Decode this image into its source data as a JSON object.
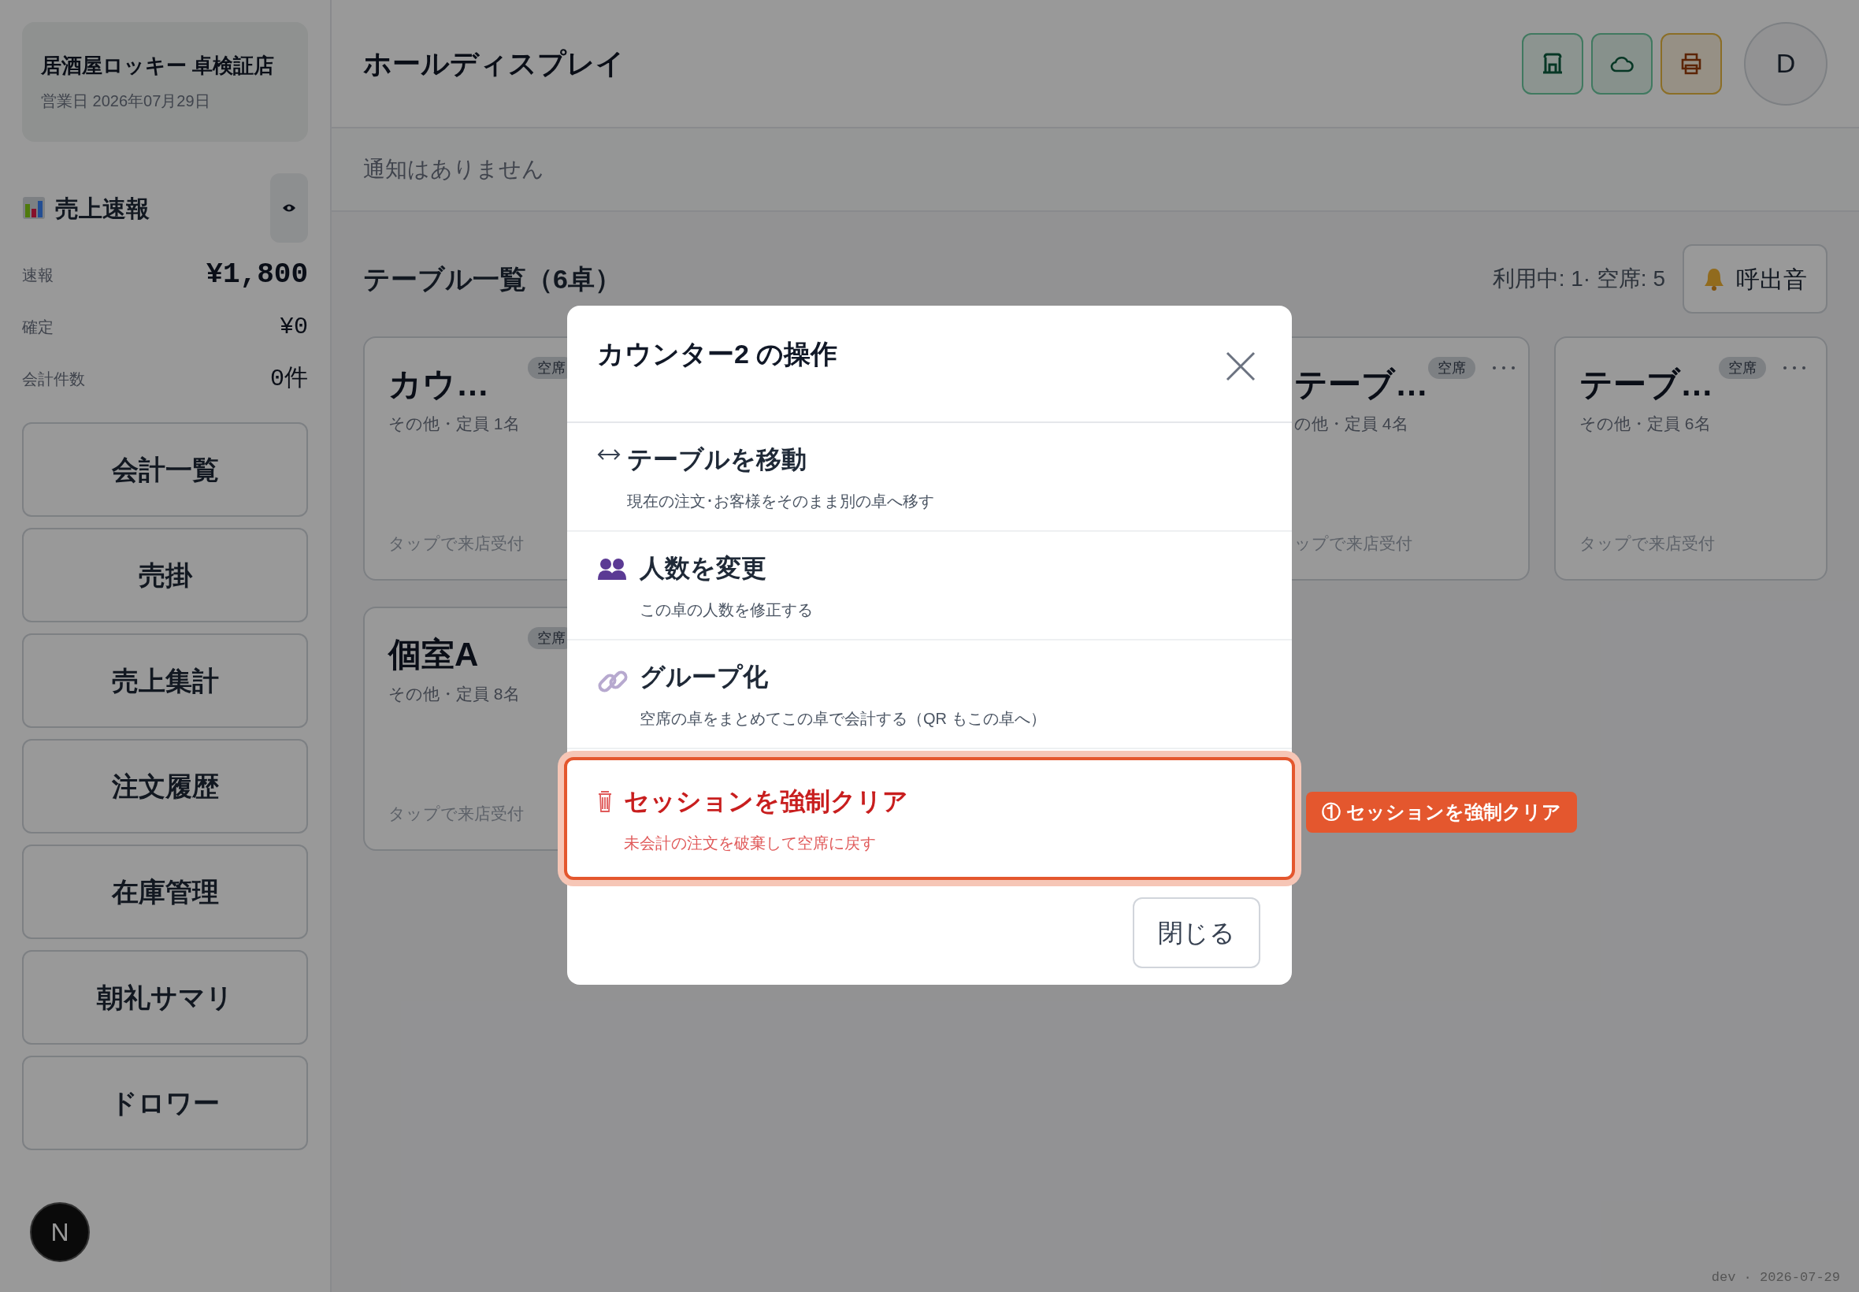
{
  "sidebar": {
    "store": {
      "name": "居酒屋ロッキー 卓検証店",
      "business_date": "営業日 2026年07月29日"
    },
    "sales": {
      "title": "売上速報",
      "rows": [
        {
          "label": "速報",
          "value": "¥1,800",
          "emphasized": true
        },
        {
          "label": "確定",
          "value": "¥0",
          "emphasized": false
        },
        {
          "label": "会計件数",
          "value": "0件",
          "emphasized": false
        }
      ]
    },
    "nav": [
      "会計一覧",
      "売掛",
      "売上集計",
      "注文履歴",
      "在庫管理",
      "朝礼サマリ",
      "ドロワー"
    ],
    "framework_badge": "N"
  },
  "header": {
    "title": "ホールディスプレイ",
    "status_buttons": [
      {
        "kind": "store"
      },
      {
        "kind": "cloud"
      },
      {
        "kind": "printer"
      }
    ],
    "avatar": "D"
  },
  "notification": "通知はありません",
  "tables_section": {
    "title": "テーブル一覧（6卓）",
    "summary": "利用中: 1· 空席: 5",
    "call_sound_button": "呼出音",
    "tables": [
      {
        "name": "カウ…",
        "status": "空席",
        "info": "その他・定員 1名",
        "hint": "タップで来店受付",
        "partly_hidden": false
      },
      {
        "name": "テーブ…",
        "status": "空席",
        "info": "の他・定員 4名",
        "hint": "ップで来店受付",
        "more_button": true,
        "partly_hidden": true
      },
      {
        "name": "テーブ…",
        "status": "空席",
        "info": "その他・定員 6名",
        "hint": "タップで来店受付",
        "more_button": true,
        "partly_hidden": false
      },
      {
        "name": "個室A",
        "status": "空席",
        "info": "その他・定員 8名",
        "hint": "タップで来店受付",
        "partly_hidden": false
      }
    ]
  },
  "modal": {
    "title": "カウンター2 の操作",
    "actions": [
      {
        "kind": "move",
        "title": "テーブルを移動",
        "description": "現在の注文･お客様をそのまま別の卓へ移す",
        "danger": false,
        "highlighted": false
      },
      {
        "kind": "guests",
        "title": "人数を変更",
        "description": "この卓の人数を修正する",
        "danger": false,
        "highlighted": false
      },
      {
        "kind": "group",
        "title": "グループ化",
        "description": "空席の卓をまとめてこの卓で会計する（QR もこの卓へ）",
        "danger": false,
        "highlighted": false
      },
      {
        "kind": "clear",
        "title": "セッションを強制クリア",
        "description": "未会計の注文を破棄して空席に戻す",
        "danger": true,
        "highlighted": true
      }
    ],
    "close_button": "閉じる"
  },
  "annotation": {
    "label": "① セッションを強制クリア"
  },
  "footer": "dev · 2026-07-29"
}
